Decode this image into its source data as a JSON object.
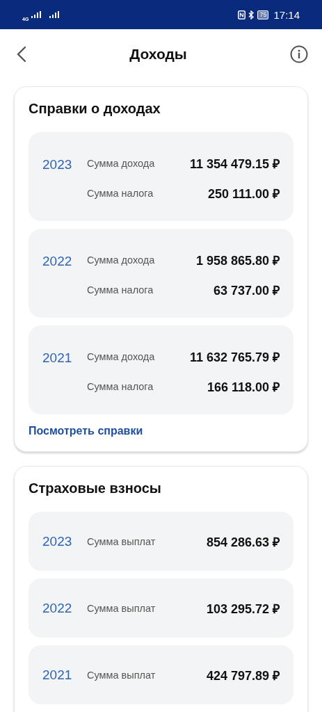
{
  "status_bar": {
    "network": "4G",
    "battery": "75",
    "time": "17:14"
  },
  "header": {
    "title": "Доходы"
  },
  "sections": [
    {
      "title": "Справки о доходах",
      "rows": [
        {
          "year": "2023",
          "lines": [
            {
              "label": "Сумма дохода",
              "amount": "11 354 479.15 ₽"
            },
            {
              "label": "Сумма налога",
              "amount": "250 111.00 ₽"
            }
          ]
        },
        {
          "year": "2022",
          "lines": [
            {
              "label": "Сумма дохода",
              "amount": "1 958 865.80 ₽"
            },
            {
              "label": "Сумма налога",
              "amount": "63 737.00 ₽"
            }
          ]
        },
        {
          "year": "2021",
          "lines": [
            {
              "label": "Сумма дохода",
              "amount": "11 632 765.79 ₽"
            },
            {
              "label": "Сумма налога",
              "amount": "166 118.00 ₽"
            }
          ]
        }
      ],
      "link": "Посмотреть справки"
    },
    {
      "title": "Страховые взносы",
      "rows": [
        {
          "year": "2023",
          "lines": [
            {
              "label": "Сумма выплат",
              "amount": "854 286.63 ₽"
            }
          ]
        },
        {
          "year": "2022",
          "lines": [
            {
              "label": "Сумма выплат",
              "amount": "103 295.72 ₽"
            }
          ]
        },
        {
          "year": "2021",
          "lines": [
            {
              "label": "Сумма выплат",
              "amount": "424 797.89 ₽"
            }
          ]
        }
      ]
    }
  ]
}
